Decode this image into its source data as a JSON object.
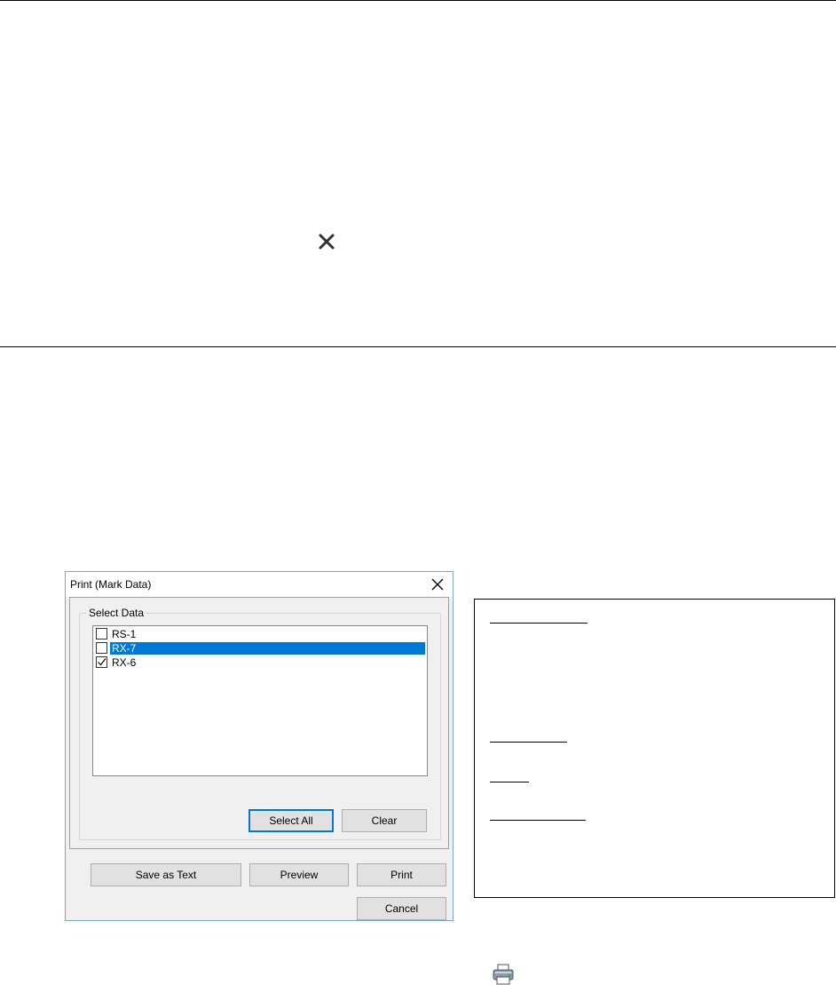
{
  "dialog": {
    "title": "Print (Mark Data)",
    "group_label": "Select Data",
    "items": [
      {
        "label": "RS-1",
        "checked": false,
        "selected": false
      },
      {
        "label": "RX-7",
        "checked": false,
        "selected": true
      },
      {
        "label": "RX-6",
        "checked": true,
        "selected": false
      }
    ],
    "buttons": {
      "select_all": "Select All",
      "clear": "Clear",
      "save_as_text": "Save as Text",
      "preview": "Preview",
      "print": "Print",
      "cancel": "Cancel"
    }
  },
  "icons": {
    "close_x": "close-icon",
    "printer": "printer-icon"
  },
  "colors": {
    "selection": "#0078d7",
    "focus_border": "#0078d7"
  }
}
